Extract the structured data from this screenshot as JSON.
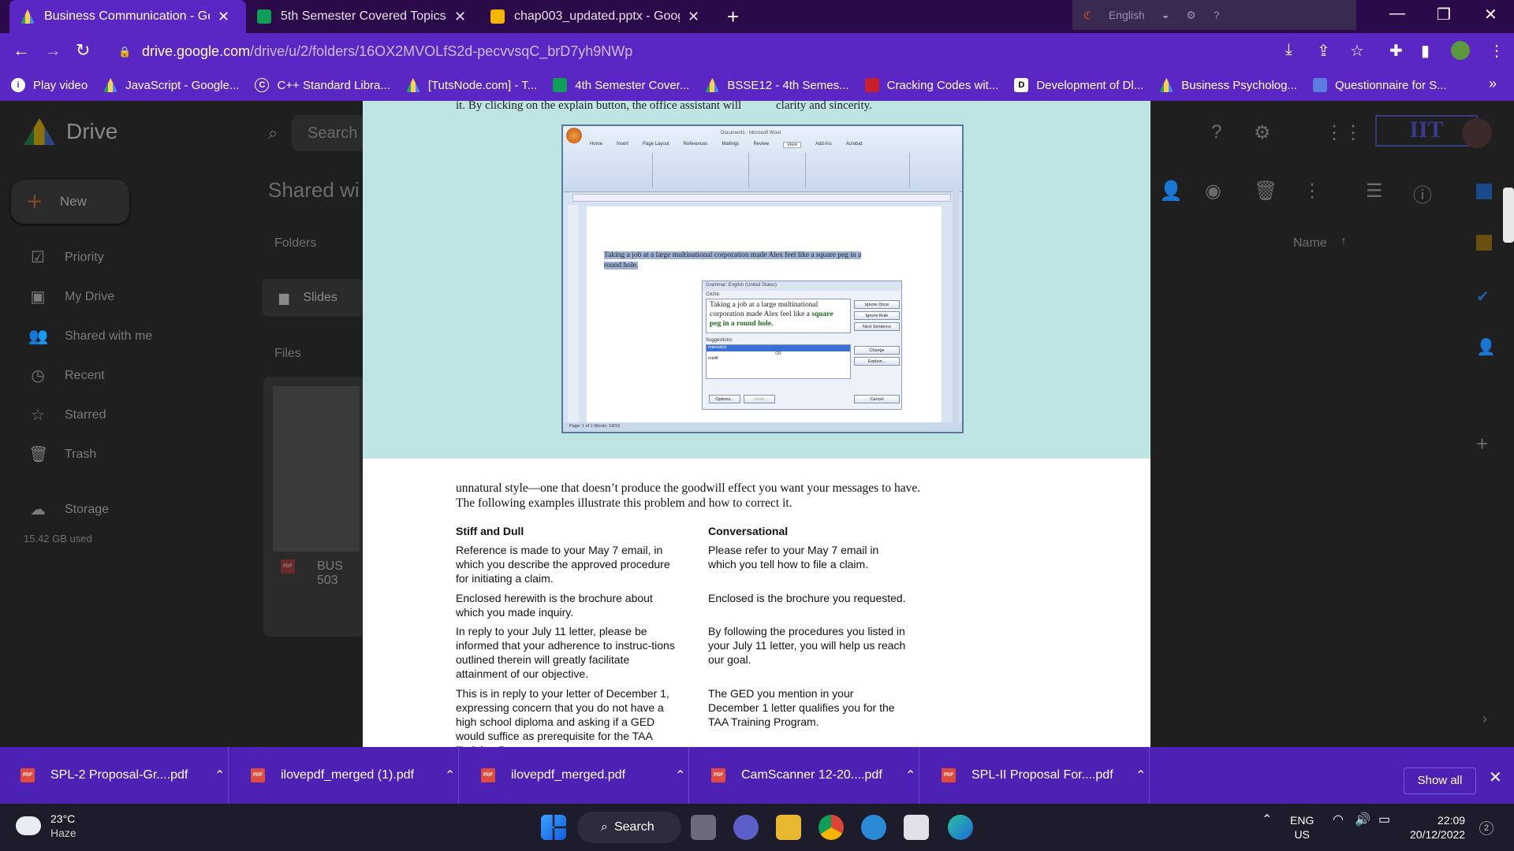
{
  "browser": {
    "tabs": [
      {
        "title": "Business Communication - Goog",
        "favicon": "drive-icon",
        "active": true
      },
      {
        "title": "5th Semester Covered Topics - G",
        "favicon": "sheets-icon",
        "active": false
      },
      {
        "title": "chap003_updated.pptx - Google",
        "favicon": "slides-icon",
        "active": false
      }
    ],
    "ime_label": "English",
    "url_host": "drive.google.com",
    "url_path": "/drive/u/2/folders/16OX2MVOLfS2d-pecvvsqC_brD7yh9NWp",
    "bookmarks": [
      {
        "label": "Play video",
        "icon": "info-icon"
      },
      {
        "label": "JavaScript - Google...",
        "icon": "drive-icon"
      },
      {
        "label": "C++ Standard Libra...",
        "icon": "cpp-icon"
      },
      {
        "label": "[TutsNode.com] - T...",
        "icon": "drive-icon"
      },
      {
        "label": "4th Semester Cover...",
        "icon": "sheets-icon"
      },
      {
        "label": "BSSE12 - 4th Semes...",
        "icon": "drive-icon"
      },
      {
        "label": "Cracking Codes wit...",
        "icon": "book-icon"
      },
      {
        "label": "Development of Dl...",
        "icon": "d-icon"
      },
      {
        "label": "Business Psycholog...",
        "icon": "drive-icon"
      },
      {
        "label": "Questionnaire for S...",
        "icon": "forms-icon"
      }
    ]
  },
  "drive": {
    "app_name": "Drive",
    "search_placeholder": "Search",
    "new_label": "New",
    "nav": [
      "Priority",
      "My Drive",
      "Shared with me",
      "Recent",
      "Starred",
      "Trash",
      "Storage"
    ],
    "storage_used": "15.42 GB used",
    "page_title": "Shared with",
    "folders_label": "Folders",
    "folder_name": "Slides",
    "files_label": "Files",
    "file_name": "BUS 503",
    "sort_label": "Name",
    "logo_text": "IIT"
  },
  "pdf": {
    "top_left_line": "it. By clicking on the explain button, the office assistant will",
    "top_right_line": "clarity and sincerity.",
    "word_window": {
      "title": "Document1 - Microsoft Word",
      "tabs": [
        "Home",
        "Insert",
        "Page Layout",
        "References",
        "Mailings",
        "Review",
        "View",
        "Add-Ins",
        "Acrobat"
      ],
      "highlighted_text": "Taking a job at a large multinational corporation made Alex feel like a square peg in a round hole.",
      "dialog_title": "Grammar: English (United States)",
      "cliche_label": "Cliché:",
      "cliche_text_plain": "Taking a job at a large multinational corporation made Alex feel like a",
      "cliche_text_bold": "square peg in a round hole.",
      "suggestions_label": "Suggestions:",
      "suggestion_1": "mismatch",
      "suggestion_or": "OR",
      "suggestion_2": "misfit",
      "btn_ignore_once": "Ignore Once",
      "btn_ignore_rule": "Ignore Rule",
      "btn_next_sentence": "Next Sentence",
      "btn_change": "Change",
      "btn_explain": "Explain...",
      "btn_options": "Options...",
      "btn_undo": "Undo",
      "btn_cancel": "Cancel",
      "status": "Page: 1 of 1   Words: 19/19"
    },
    "paragraph": "unnatural style—one that doesn’t produce the goodwill effect you want your messages to have. The following examples illustrate this problem and how to correct it.",
    "col1_head": "Stiff and Dull",
    "col2_head": "Conversational",
    "rows": [
      {
        "stiff": "Reference is made to your May 7 email, in which you describe the approved procedure for initiating a claim.",
        "conv": "Please refer to your May 7 email in which you tell how to file a claim."
      },
      {
        "stiff": "Enclosed herewith is the brochure about which you made inquiry.",
        "conv": "Enclosed is the brochure you requested."
      },
      {
        "stiff": "In reply to your July 11 letter, please be informed that your adherence to instruc-tions outlined therein will greatly facilitate attainment of our objective.",
        "conv": "By following the procedures you listed in your July 11 letter, you will help us reach our goal."
      },
      {
        "stiff": "This is in reply to your letter of December 1, expressing concern that you do not have a high school diploma and asking if a GED would suffice as prerequisite for the TAA Training Program.",
        "conv": "The GED you mention in your December 1 letter qualifies you for the TAA Training Program."
      }
    ]
  },
  "downloads": {
    "items": [
      "SPL-2 Proposal-Gr....pdf",
      "ilovepdf_merged (1).pdf",
      "ilovepdf_merged.pdf",
      "CamScanner 12-20....pdf",
      "SPL-II Proposal For....pdf"
    ],
    "show_all": "Show all"
  },
  "taskbar": {
    "temperature": "23°C",
    "weather": "Haze",
    "search_label": "Search",
    "lang_top": "ENG",
    "lang_bottom": "US",
    "time": "22:09",
    "date": "20/12/2022",
    "notification_count": "2"
  },
  "colors": {
    "tab_active": "#5a27c5",
    "tabstrip": "#2a0a48",
    "downloads_bar": "#4e21b5",
    "figure_bg": "#bfe4e4"
  }
}
